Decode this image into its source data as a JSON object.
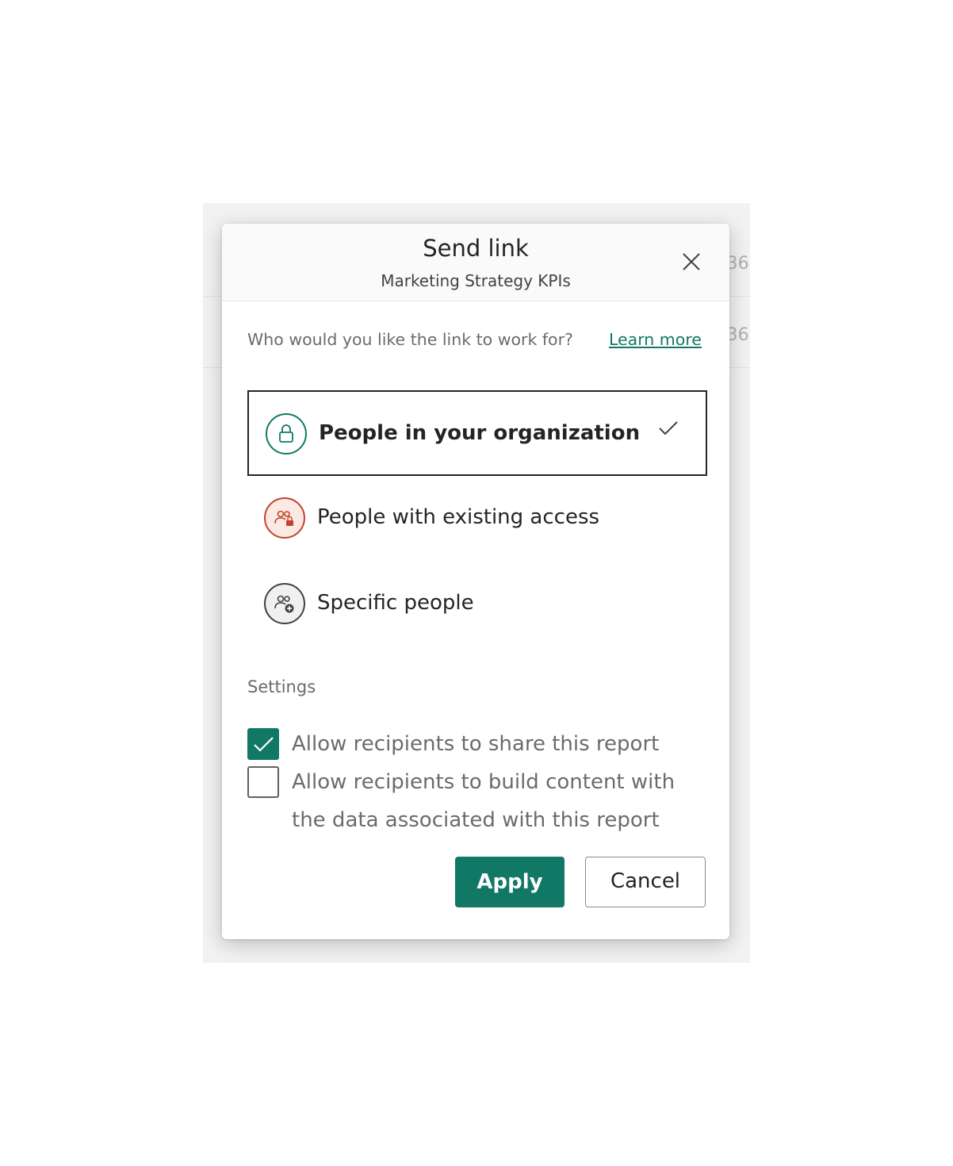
{
  "background": {
    "row_cells": [
      "36:",
      "36:"
    ]
  },
  "dialog": {
    "title": "Send link",
    "subtitle": "Marketing Strategy KPIs",
    "close_icon": "close-icon",
    "question": "Who would you like the link to work for?",
    "learn_more": "Learn more",
    "options": [
      {
        "label": "People in your organization",
        "icon": "lock-icon",
        "color": "#117865",
        "selected": true
      },
      {
        "label": "People with existing access",
        "icon": "people-lock-icon",
        "color": "#c4432c",
        "selected": false
      },
      {
        "label": "Specific people",
        "icon": "people-add-icon",
        "color": "#424242",
        "selected": false
      }
    ],
    "settings_label": "Settings",
    "checkboxes": [
      {
        "label": "Allow recipients to share this report",
        "checked": true
      },
      {
        "label": "Allow recipients to build content with the data associated with this report",
        "checked": false
      }
    ],
    "apply_label": "Apply",
    "cancel_label": "Cancel",
    "accent_color": "#117865"
  }
}
